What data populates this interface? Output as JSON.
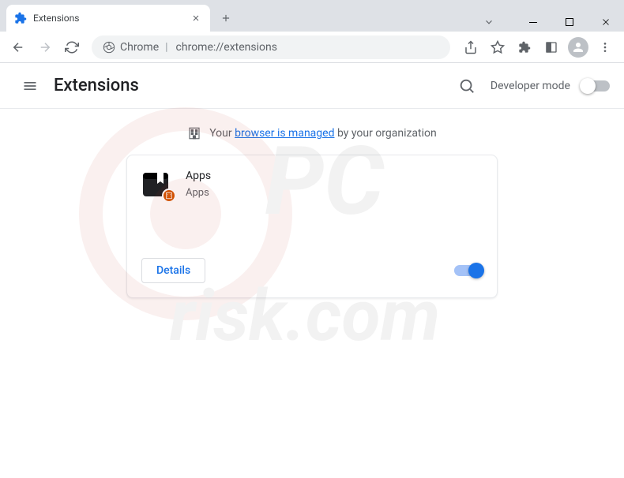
{
  "window": {
    "tab_title": "Extensions",
    "new_tab": "+"
  },
  "toolbar": {
    "chrome_label": "Chrome",
    "url": "chrome://extensions"
  },
  "header": {
    "title": "Extensions",
    "dev_mode_label": "Developer mode",
    "dev_mode_on": false
  },
  "managed": {
    "prefix": "Your ",
    "link": "browser is managed",
    "suffix": " by your organization"
  },
  "extension": {
    "name": "Apps",
    "description": "Apps",
    "details_label": "Details",
    "enabled": true
  },
  "watermark_text": "PCrisk.com"
}
